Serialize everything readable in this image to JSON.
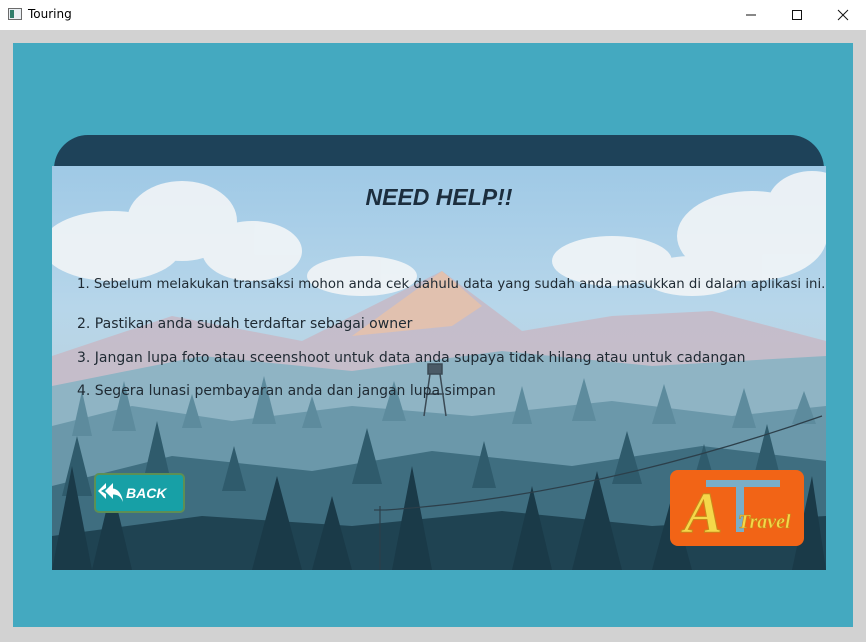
{
  "window": {
    "title": "Touring",
    "minimize_icon": "minimize-icon",
    "maximize_icon": "maximize-icon",
    "close_icon": "close-icon"
  },
  "help": {
    "title": "NEED HELP!!",
    "items": [
      "1. Sebelum melakukan transaksi mohon anda cek dahulu data yang sudah anda masukkan di dalam aplikasi ini.",
      "2. Pastikan anda sudah terdaftar sebagai owner",
      "3. Jangan lupa foto atau sceenshoot untuk data anda supaya tidak hilang atau untuk cadangan",
      "4. Segera lunasi pembayaran anda dan jangan lupa simpan"
    ]
  },
  "back_button": {
    "label": "BACK",
    "icon": "reply-all-icon"
  },
  "logo": {
    "letter": "A",
    "text": "Travel",
    "icon": "travel-logo"
  },
  "colors": {
    "panel": "#44a9c0",
    "header_bar": "#1e4259",
    "back_button": "#17a0a6",
    "logo_bg": "#f26416"
  }
}
